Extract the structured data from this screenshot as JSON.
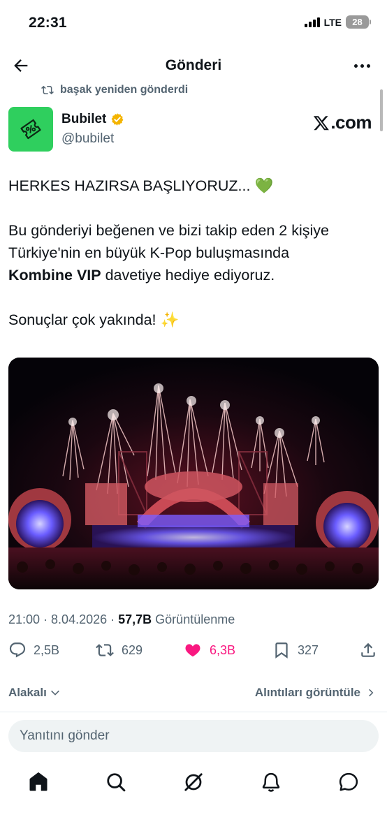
{
  "status_bar": {
    "time": "22:31",
    "network": "LTE",
    "battery": "28"
  },
  "header": {
    "title": "Gönderi"
  },
  "repost": {
    "text": "başak yeniden gönderdi"
  },
  "author": {
    "name": "Bubilet",
    "handle": "@bubilet"
  },
  "source": {
    "label": ".com"
  },
  "post": {
    "line1": "HERKES HAZIRSA BAŞLIYORUZ... 💚",
    "line2": "Bu gönderiyi beğenen ve bizi takip eden 2 kişiye",
    "line3": "Türkiye'nin en büyük K-Pop buluşmasında",
    "line4_bold": "Kombine VIP",
    "line4_rest": " davetiye hediye ediyoruz.",
    "line5": "Sonuçlar çok yakında! ✨"
  },
  "meta": {
    "time_date": "21:00 · 8.04.2026 · ",
    "views_count": "57,7B",
    "views_label": " Görüntülenme"
  },
  "actions": {
    "replies": "2,5B",
    "reposts": "629",
    "likes": "6,3B",
    "bookmarks": "327"
  },
  "colors": {
    "like": "#f91880",
    "avatar": "#2fcf5e",
    "verified": "#f4b400",
    "muted": "#536471"
  },
  "filters": {
    "sort_label": "Alakalı",
    "quotes_label": "Alıntıları görüntüle"
  },
  "reply": {
    "placeholder": "Yanıtını gönder"
  },
  "nav": [
    "home-icon",
    "search-icon",
    "grok-icon",
    "notifications-icon",
    "messages-icon"
  ]
}
